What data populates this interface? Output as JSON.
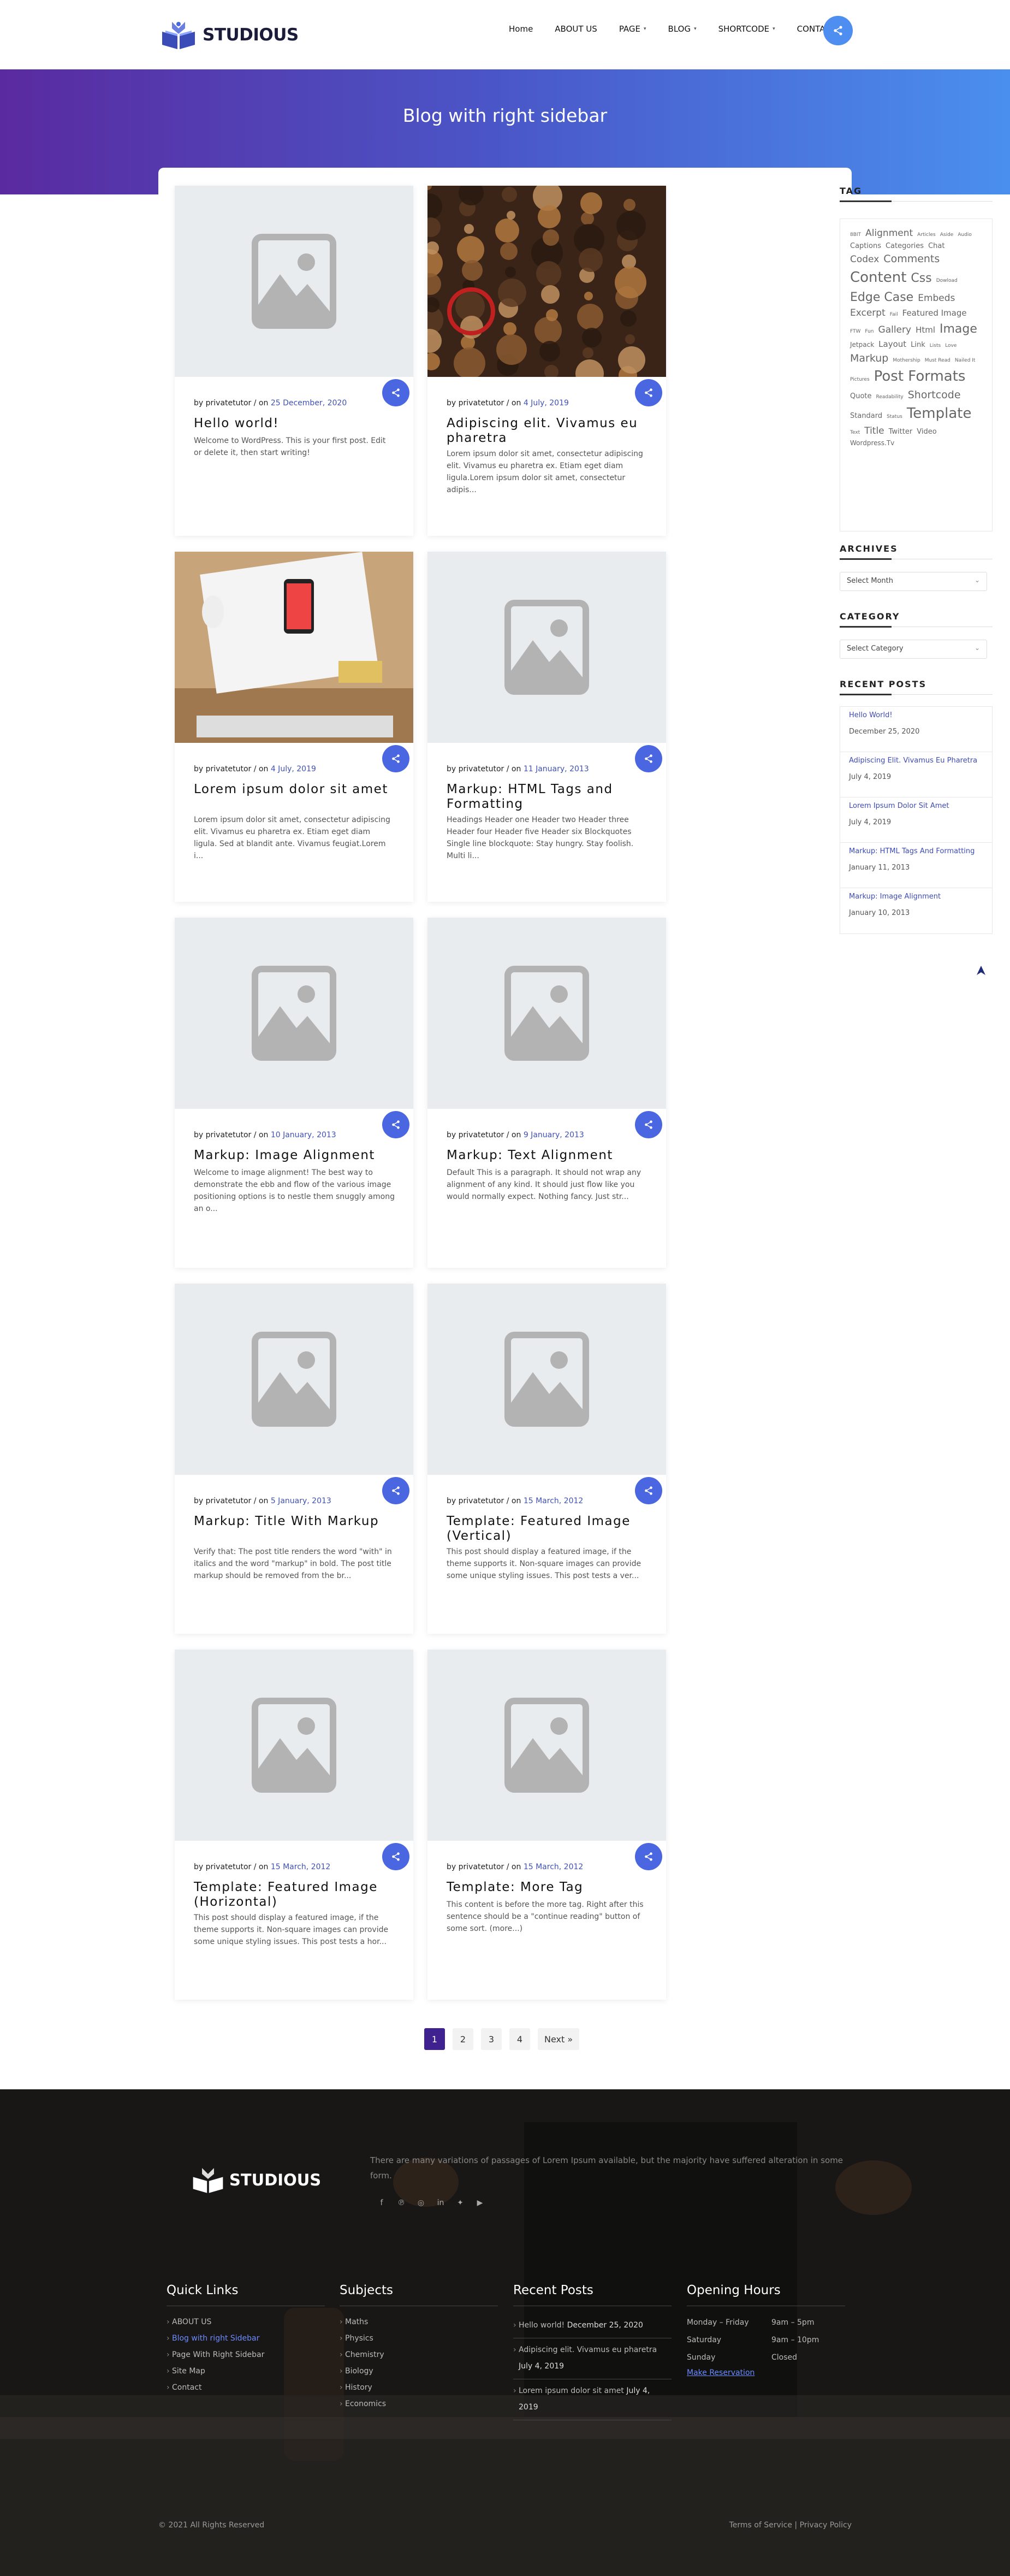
{
  "brand": {
    "name": "STUDIOUS"
  },
  "nav": {
    "items": [
      "Home",
      "ABOUT US",
      "PAGE",
      "BLOG",
      "SHORTCODE",
      "CONTACT"
    ]
  },
  "banner": {
    "title": "Blog with right sidebar"
  },
  "posts": [
    {
      "author": "privatetutor",
      "date": "25 December, 2020",
      "title": "Hello world!",
      "excerpt": "Welcome to WordPress. This is your first post. Edit or delete it, then start writing!",
      "image": "placeholder"
    },
    {
      "author": "privatetutor",
      "date": "4 July, 2019",
      "title": "Adipiscing elit. Vivamus eu pharetra",
      "excerpt": "Lorem ipsum dolor sit amet, consectetur adipiscing elit. Vivamus eu pharetra ex. Etiam eget diam ligula.Lorem ipsum dolor sit amet, consectetur adipis...",
      "image": "machinery"
    },
    {
      "author": "privatetutor",
      "date": "4 July, 2019",
      "title": "Lorem ipsum dolor sit amet",
      "excerpt": "Lorem ipsum dolor sit amet, consectetur adipiscing elit. Vivamus eu pharetra ex. Etiam eget diam ligula. Sed at blandit ante. Vivamus feugiat.Lorem i...",
      "image": "desk"
    },
    {
      "author": "privatetutor",
      "date": "11 January, 2013",
      "title": "Markup: HTML Tags and Formatting",
      "excerpt": "Headings Header one Header two Header three Header four Header five Header six Blockquotes Single line blockquote: Stay hungry. Stay foolish. Multi li...",
      "image": "placeholder"
    },
    {
      "author": "privatetutor",
      "date": "10 January, 2013",
      "title": "Markup: Image Alignment",
      "excerpt": "Welcome to image alignment! The best way to demonstrate the ebb and flow of the various image positioning options is to nestle them snuggly among an o...",
      "image": "placeholder"
    },
    {
      "author": "privatetutor",
      "date": "9 January, 2013",
      "title": "Markup: Text Alignment",
      "excerpt": "Default This is a paragraph. It should not wrap any alignment of any kind. It should just flow like you would normally expect. Nothing fancy. Just str...",
      "image": "placeholder"
    },
    {
      "author": "privatetutor",
      "date": "5 January, 2013",
      "title": "Markup: Title With Markup",
      "excerpt": "Verify that: The post title renders the word \"with\" in italics and the word \"markup\" in bold. The post title markup should be removed from the br...",
      "image": "placeholder"
    },
    {
      "author": "privatetutor",
      "date": "15 March, 2012",
      "title": "Template: Featured Image (Vertical)",
      "excerpt": "This post should display a featured image, if the theme supports it. Non-square images can provide some unique styling issues. This post tests a ver...",
      "image": "placeholder"
    },
    {
      "author": "privatetutor",
      "date": "15 March, 2012",
      "title": "Template: Featured Image (Horizontal)",
      "excerpt": "This post should display a featured image, if the theme supports it. Non-square images can provide some unique styling issues. This post tests a hor...",
      "image": "placeholder"
    },
    {
      "author": "privatetutor",
      "date": "15 March, 2012",
      "title": "Template: More Tag",
      "excerpt": "This content is before the more tag. Right after this sentence should be a \"continue reading\" button of some sort. (more...)",
      "image": "placeholder"
    }
  ],
  "labels": {
    "by": "by",
    "on": "on"
  },
  "sidebar": {
    "tag_title": "TAG",
    "tags": [
      {
        "t": "8BIT",
        "s": 9
      },
      {
        "t": "Alignment",
        "s": 17
      },
      {
        "t": "Articles",
        "s": 9
      },
      {
        "t": "Aside",
        "s": 9
      },
      {
        "t": "Audio",
        "s": 9
      },
      {
        "t": "Captions",
        "s": 13
      },
      {
        "t": "Categories",
        "s": 13
      },
      {
        "t": "Chat",
        "s": 13
      },
      {
        "t": "Codex",
        "s": 17
      },
      {
        "t": "Comments",
        "s": 19
      },
      {
        "t": "Content",
        "s": 26
      },
      {
        "t": "Css",
        "s": 22
      },
      {
        "t": "Dowload",
        "s": 9
      },
      {
        "t": "Edge Case",
        "s": 22
      },
      {
        "t": "Embeds",
        "s": 17
      },
      {
        "t": "Excerpt",
        "s": 17
      },
      {
        "t": "Fail",
        "s": 9
      },
      {
        "t": "Featured Image",
        "s": 15
      },
      {
        "t": "FTW",
        "s": 9
      },
      {
        "t": "Fun",
        "s": 9
      },
      {
        "t": "Gallery",
        "s": 17
      },
      {
        "t": "Html",
        "s": 15
      },
      {
        "t": "Image",
        "s": 22
      },
      {
        "t": "Jetpack",
        "s": 12
      },
      {
        "t": "Layout",
        "s": 15
      },
      {
        "t": "Link",
        "s": 13
      },
      {
        "t": "Lists",
        "s": 9
      },
      {
        "t": "Love",
        "s": 9
      },
      {
        "t": "Markup",
        "s": 19
      },
      {
        "t": "Mothership",
        "s": 9
      },
      {
        "t": "Must Read",
        "s": 9
      },
      {
        "t": "Nailed It",
        "s": 9
      },
      {
        "t": "Pictures",
        "s": 9
      },
      {
        "t": "Post Formats",
        "s": 26
      },
      {
        "t": "Quote",
        "s": 13
      },
      {
        "t": "Readability",
        "s": 9
      },
      {
        "t": "Shortcode",
        "s": 19
      },
      {
        "t": "Standard",
        "s": 13
      },
      {
        "t": "Status",
        "s": 9
      },
      {
        "t": "Template",
        "s": 26
      },
      {
        "t": "Text",
        "s": 9
      },
      {
        "t": "Title",
        "s": 17
      },
      {
        "t": "Twitter",
        "s": 13
      },
      {
        "t": "Video",
        "s": 13
      },
      {
        "t": "Wordpress.Tv",
        "s": 12
      }
    ],
    "archives_title": "ARCHIVES",
    "archives_select": "Select Month",
    "category_title": "CATEGORY",
    "category_select": "Select Category",
    "recent_title": "RECENT POSTS",
    "recent": [
      {
        "title": "Hello World!",
        "date": "December 25, 2020"
      },
      {
        "title": "Adipiscing Elit. Vivamus Eu Pharetra",
        "date": "July 4, 2019"
      },
      {
        "title": "Lorem Ipsum Dolor Sit Amet",
        "date": "July 4, 2019"
      },
      {
        "title": "Markup: HTML Tags And Formatting",
        "date": "January 11, 2013"
      },
      {
        "title": "Markup: Image Alignment",
        "date": "January 10, 2013"
      }
    ]
  },
  "pagination": {
    "pages": [
      "1",
      "2",
      "3",
      "4"
    ],
    "next": "Next »",
    "active": "1"
  },
  "footer": {
    "brand": "STUDIOUS",
    "about": "There are many variations of passages of Lorem Ipsum available, but the majority have suffered alteration in some form.",
    "quick_links_title": "Quick Links",
    "quick_links": [
      "ABOUT US",
      "Blog with right Sidebar",
      "Page With Right Sidebar",
      "Site Map",
      "Contact"
    ],
    "subjects_title": "Subjects",
    "subjects": [
      "Maths",
      "Physics",
      "Chemistry",
      "Biology",
      "History",
      "Economics"
    ],
    "recent_title": "Recent Posts",
    "recent": [
      {
        "title": "Hello world!",
        "date": "December 25, 2020"
      },
      {
        "title": "Adipiscing elit. Vivamus eu pharetra",
        "date": "July 4, 2019"
      },
      {
        "title": "Lorem ipsum dolor sit amet",
        "date": "July 4, 2019"
      }
    ],
    "hours_title": "Opening Hours",
    "hours": [
      {
        "day": "Monday – Friday",
        "time": "9am – 5pm"
      },
      {
        "day": "Saturday",
        "time": "9am – 10pm"
      },
      {
        "day": "Sunday",
        "time": "Closed"
      }
    ],
    "reservation": "Make Reservation",
    "copyright": "© 2021 All Rights Reserved",
    "terms": "Terms of Service",
    "separator": "|",
    "privacy": "Privacy Policy"
  },
  "colors": {
    "accent": "#4a66e0",
    "brand_purple": "#3f2190",
    "banner_start": "#5a2aa0",
    "banner_end": "#4a8fee"
  }
}
